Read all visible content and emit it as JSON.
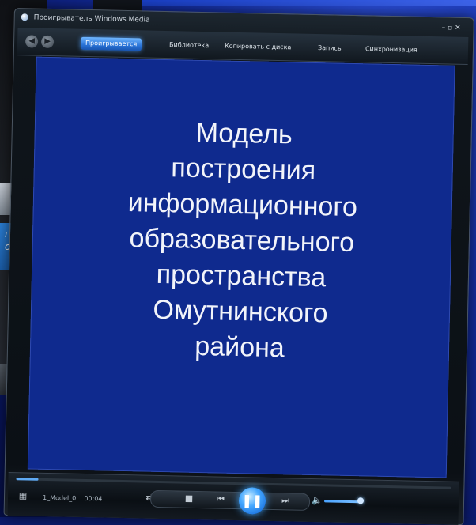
{
  "app": {
    "title": "Проигрыватель Windows Media"
  },
  "tabs": [
    {
      "label": "Проигрывается",
      "active": true
    },
    {
      "label": "Библиотека",
      "active": false
    },
    {
      "label": "Копировать с диска",
      "active": false
    },
    {
      "label": "Запись",
      "active": false
    },
    {
      "label": "Синхронизация",
      "active": false
    }
  ],
  "video": {
    "lines": [
      "Модель",
      "построения",
      "информационного",
      "образовательного",
      "пространства",
      "Омутнинского",
      "района"
    ],
    "background": "#0f2a8e"
  },
  "status": {
    "filename": "1_Model_0",
    "time": "00:04"
  },
  "controls": {
    "play_state": "playing",
    "seek_fraction": 0.05,
    "volume_fraction": 0.8
  },
  "background_window": {
    "fragment_text": [
      "ге",
      "ор"
    ]
  },
  "icons": {
    "back": "back-arrow-icon",
    "forward": "forward-arrow-icon",
    "shuffle": "shuffle-icon",
    "repeat": "repeat-icon",
    "stop": "stop-icon",
    "previous": "previous-icon",
    "play_pause": "pause-icon",
    "next": "next-icon",
    "mute": "speaker-icon",
    "view": "view-mode-icon"
  }
}
